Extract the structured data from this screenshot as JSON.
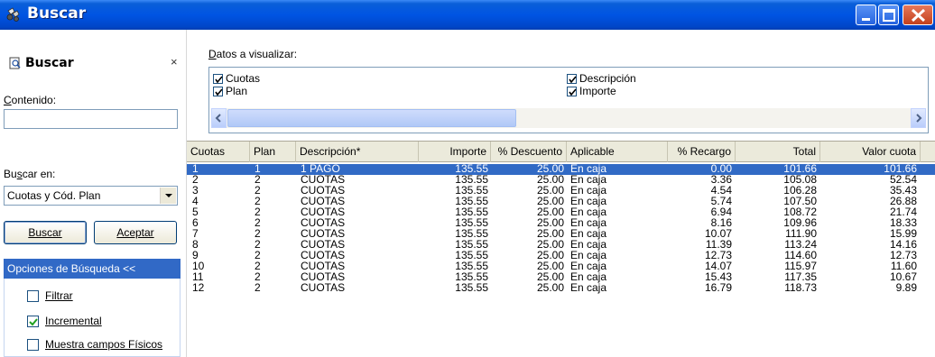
{
  "window": {
    "title": "Buscar"
  },
  "left_panel": {
    "header": "Buscar",
    "close_glyph": "×",
    "content_label": "Contenido:",
    "content_value": "",
    "search_in_label": "Buscar en:",
    "search_in_value": "Cuotas y Cód. Plan",
    "search_button": "Buscar",
    "accept_button": "Aceptar",
    "options_header": "Opciones de Búsqueda  <<",
    "options": [
      {
        "label": "Filtrar",
        "checked": false
      },
      {
        "label": "Incremental",
        "checked": true
      },
      {
        "label": "Muestra campos Físicos",
        "checked": false
      }
    ]
  },
  "display": {
    "title": "Datos a visualizar:",
    "items": [
      {
        "label": "Cuotas",
        "checked": true
      },
      {
        "label": "Plan",
        "checked": true
      },
      {
        "label": "Descripción",
        "checked": true
      },
      {
        "label": "Importe",
        "checked": true
      }
    ]
  },
  "grid": {
    "columns": [
      "Cuotas",
      "Plan",
      "Descripción*",
      "Importe",
      "% Descuento",
      "Aplicable",
      "% Recargo",
      "Total",
      "Valor cuota"
    ],
    "selected_row": 0,
    "rows": [
      [
        "1",
        "1",
        "1 PAGO",
        "135.55",
        "25.00",
        "En caja",
        "0.00",
        "101.66",
        "101.66"
      ],
      [
        "2",
        "2",
        "CUOTAS",
        "135.55",
        "25.00",
        "En caja",
        "3.36",
        "105.08",
        "52.54"
      ],
      [
        "3",
        "2",
        "CUOTAS",
        "135.55",
        "25.00",
        "En caja",
        "4.54",
        "106.28",
        "35.43"
      ],
      [
        "4",
        "2",
        "CUOTAS",
        "135.55",
        "25.00",
        "En caja",
        "5.74",
        "107.50",
        "26.88"
      ],
      [
        "5",
        "2",
        "CUOTAS",
        "135.55",
        "25.00",
        "En caja",
        "6.94",
        "108.72",
        "21.74"
      ],
      [
        "6",
        "2",
        "CUOTAS",
        "135.55",
        "25.00",
        "En caja",
        "8.16",
        "109.96",
        "18.33"
      ],
      [
        "7",
        "2",
        "CUOTAS",
        "135.55",
        "25.00",
        "En caja",
        "10.07",
        "111.90",
        "15.99"
      ],
      [
        "8",
        "2",
        "CUOTAS",
        "135.55",
        "25.00",
        "En caja",
        "11.39",
        "113.24",
        "14.16"
      ],
      [
        "9",
        "2",
        "CUOTAS",
        "135.55",
        "25.00",
        "En caja",
        "12.73",
        "114.60",
        "12.73"
      ],
      [
        "10",
        "2",
        "CUOTAS",
        "135.55",
        "25.00",
        "En caja",
        "14.07",
        "115.97",
        "11.60"
      ],
      [
        "11",
        "2",
        "CUOTAS",
        "135.55",
        "25.00",
        "En caja",
        "15.43",
        "117.35",
        "10.67"
      ],
      [
        "12",
        "2",
        "CUOTAS",
        "135.55",
        "25.00",
        "En caja",
        "16.79",
        "118.73",
        "9.89"
      ]
    ]
  },
  "colors": {
    "titlebar": "#0054e3",
    "selection": "#316ac5",
    "options_header": "#3169c6"
  }
}
